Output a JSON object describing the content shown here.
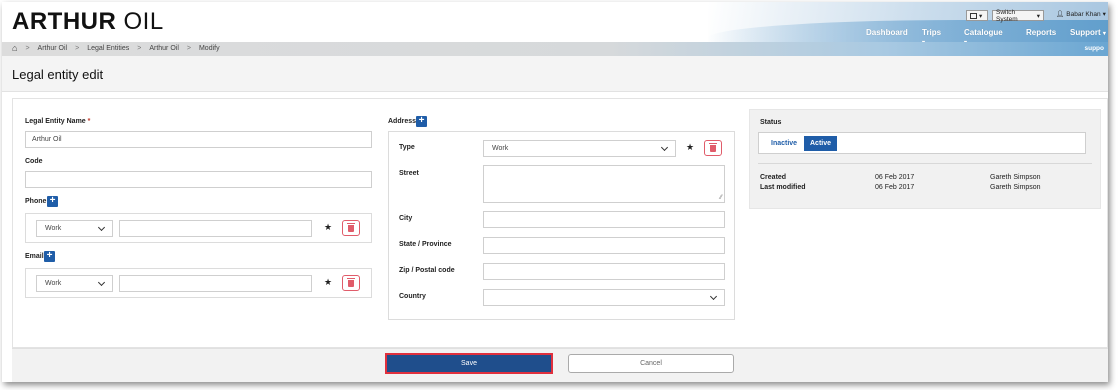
{
  "header": {
    "logo_bold": "ARTHUR",
    "logo_light": "OIL",
    "switch_system": "Switch System",
    "user_name": "Babar Khan",
    "nav": [
      "Dashboard",
      "Trips",
      "Catalogue",
      "Reports",
      "Support"
    ],
    "support_small": "suppo"
  },
  "breadcrumb": [
    "Arthur Oil",
    "Legal Entities",
    "Arthur Oil",
    "Modify"
  ],
  "page_title": "Legal entity edit",
  "form": {
    "name_label": "Legal Entity Name",
    "name_required": "*",
    "name_value": "Arthur Oil",
    "code_label": "Code",
    "code_value": "",
    "phone_label": "Phone",
    "phone_type": "Work",
    "phone_value": "",
    "email_label": "Email",
    "email_type": "Work",
    "email_value": ""
  },
  "address": {
    "label": "Address",
    "type_label": "Type",
    "type_value": "Work",
    "street_label": "Street",
    "city_label": "City",
    "state_label": "State / Province",
    "zip_label": "Zip / Postal code",
    "country_label": "Country",
    "country_value": ""
  },
  "status": {
    "label": "Status",
    "inactive": "Inactive",
    "active": "Active",
    "active_color": "#1f5da8",
    "created_label": "Created",
    "created_date": "06 Feb 2017",
    "created_by": "Gareth Simpson",
    "modified_label": "Last modified",
    "modified_date": "06 Feb 2017",
    "modified_by": "Gareth Simpson"
  },
  "footer": {
    "save": "Save",
    "cancel": "Cancel"
  }
}
